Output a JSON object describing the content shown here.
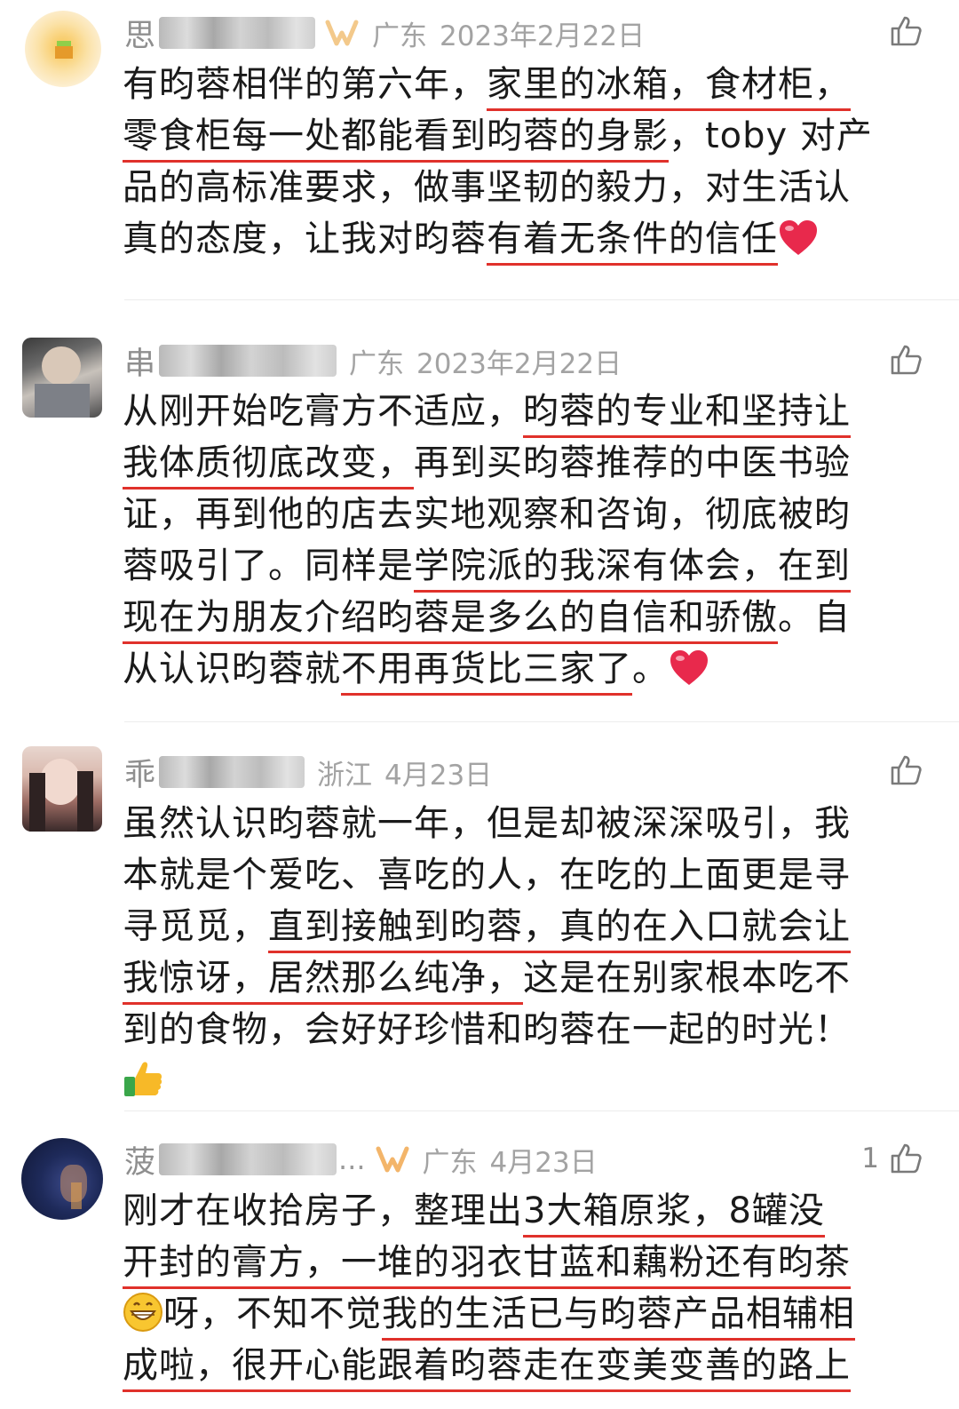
{
  "comments": [
    {
      "username_visible": "思",
      "location": "广东",
      "date": "2023年2月22日",
      "like_count": "",
      "lines": [
        [
          "有昀蓉相伴的第六年，",
          "家里的冰箱，食材柜，"
        ],
        [
          "零食柜每一处都能看到昀蓉的身影",
          "，toby 对产"
        ],
        [
          "品的高标准要求，做事坚韧的毅力，对生活认"
        ],
        [
          "真的态度，让我对昀蓉",
          "有着无条件的信任"
        ]
      ],
      "emoji": "heart"
    },
    {
      "username_visible": "串",
      "location": "广东",
      "date": "2023年2月22日",
      "like_count": "",
      "lines": [
        [
          "从刚开始吃膏方不适应，",
          "昀蓉的专业和坚持让"
        ],
        [
          "我体质彻底改变，",
          "再到买昀蓉推荐的中医书验"
        ],
        [
          "证，再到他的店去实地观察和咨询，彻底被昀"
        ],
        [
          "蓉吸引了。同样是",
          "学院派的我深有体会，在到"
        ],
        [
          "现在为朋友介绍昀蓉是多么的自信和骄傲",
          "。自"
        ],
        [
          "从认识昀蓉就",
          "不用再货比三家了",
          "。"
        ]
      ],
      "emoji": "heart"
    },
    {
      "username_visible": "乖",
      "location": "浙江",
      "date": "4月23日",
      "like_count": "",
      "lines": [
        [
          "虽然认识昀蓉就一年，但是却被深深吸引，我"
        ],
        [
          "本就是个爱吃、喜吃的人，在吃的上面更是寻"
        ],
        [
          "寻觅觅，",
          "直到接触到昀蓉，真的在入口就会让"
        ],
        [
          "我惊讶，居然那么纯净，",
          "这是在别家根本吃不"
        ],
        [
          "到的食物，会好好珍惜和昀蓉在一起的时光！"
        ]
      ],
      "emoji": "thumbs-up"
    },
    {
      "username_visible": "菠",
      "username_suffix": "...",
      "location": "广东",
      "date": "4月23日",
      "like_count": "1",
      "lines": [
        [
          "刚才在收拾房子，整理出",
          "3大箱原浆，8罐没"
        ],
        [
          "开封的膏方，一堆的羽衣甘蓝和藕粉还有昀茶"
        ],
        [
          "呀，不知不觉",
          "我的生活已与昀蓉产品相辅相"
        ],
        [
          "成啦，很开心能跟着昀蓉走在变美变善的路上"
        ]
      ],
      "emoji": "grin"
    }
  ],
  "colors": {
    "underline": "#e0312b",
    "meta_text": "#a3a3a3",
    "body_text": "#1a1a1a"
  },
  "icons": {
    "like": "thumbs-up-outline-icon",
    "heart": "red-heart-emoji",
    "thumbs": "thumbs-up-emoji",
    "grin": "grinning-face-emoji",
    "badge": "member-badge-icon"
  }
}
